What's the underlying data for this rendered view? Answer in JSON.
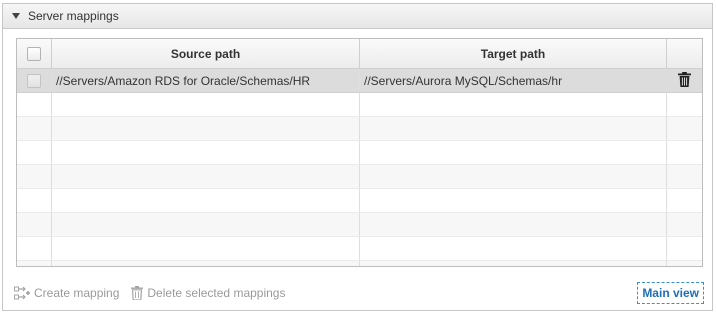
{
  "panel": {
    "title": "Server mappings"
  },
  "table": {
    "columns": {
      "source": "Source path",
      "target": "Target path"
    },
    "rows": [
      {
        "source": "//Servers/Amazon RDS for Oracle/Schemas/HR",
        "target": "//Servers/Aurora MySQL/Schemas/hr",
        "action_icon": "trash-icon"
      }
    ]
  },
  "footer": {
    "create_label": "Create mapping",
    "delete_label": "Delete selected mappings",
    "main_view_label": "Main view"
  },
  "colors": {
    "selected_row": "#dcdcdc",
    "link_accent": "#1f6fb8",
    "disabled_text": "#9a9a9a"
  }
}
